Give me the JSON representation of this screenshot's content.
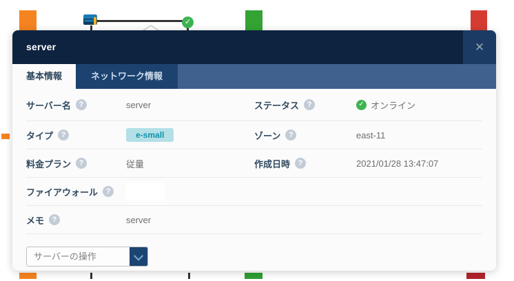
{
  "modal": {
    "title": "server",
    "tabs": {
      "basic": "基本情報",
      "network": "ネットワーク情報"
    },
    "fields": {
      "server_name": {
        "label": "サーバー名",
        "value": "server"
      },
      "status": {
        "label": "ステータス",
        "value": "オンライン"
      },
      "type": {
        "label": "タイプ",
        "value": "e-small"
      },
      "zone": {
        "label": "ゾーン",
        "value": "east-11"
      },
      "plan": {
        "label": "料金プラン",
        "value": "従量"
      },
      "created": {
        "label": "作成日時",
        "value": "2021/01/28 13:47:07"
      },
      "firewall": {
        "label": "ファイアウォール",
        "value": ""
      },
      "memo": {
        "label": "メモ",
        "value": "server"
      }
    },
    "action_select": {
      "label": "サーバーの操作"
    }
  },
  "icons": {
    "close": "✕",
    "help": "?",
    "check": "✓"
  },
  "colors": {
    "header_bg": "#0d2340",
    "tab_bar_bg": "#40608e",
    "tab_inactive_bg": "#1c4270",
    "tab_active_bg": "#fbfbfb",
    "action_button_navy": "#1c4573",
    "status_green": "#3db453",
    "badge_bg": "#b3e0e7",
    "badge_text": "#1391a8",
    "block_orange": "#f5831f",
    "block_green": "#33a434",
    "block_red": "#d53b31"
  }
}
